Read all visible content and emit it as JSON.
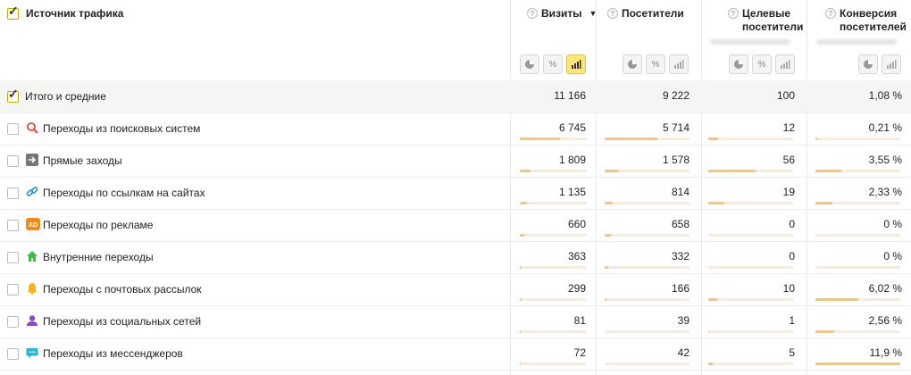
{
  "header": {
    "source_title": "Источник трафика",
    "columns": [
      {
        "id": "visits",
        "label": "Визиты",
        "sort": "▼"
      },
      {
        "id": "visitors",
        "label": "Посетители"
      },
      {
        "id": "target",
        "label": "Целевые посетители"
      },
      {
        "id": "conversion",
        "label": "Конверсия посетителей"
      }
    ]
  },
  "total": {
    "label": "Итого и средние",
    "visits": "11 166",
    "visitors": "9 222",
    "target": "100",
    "conversion": "1,08 %"
  },
  "rows": [
    {
      "label": "Переходы из поисковых систем",
      "icon": "search-icon",
      "visits": "6 745",
      "visitors": "5 714",
      "target": "12",
      "conversion": "0,21 %",
      "f": [
        0.6,
        0.62,
        0.12,
        0.02
      ]
    },
    {
      "label": "Прямые заходы",
      "icon": "arrow-right-icon",
      "visits": "1 809",
      "visitors": "1 578",
      "target": "56",
      "conversion": "3,55 %",
      "f": [
        0.16,
        0.17,
        0.56,
        0.3
      ]
    },
    {
      "label": "Переходы по ссылкам на сайтах",
      "icon": "link-icon",
      "visits": "1 135",
      "visitors": "814",
      "target": "19",
      "conversion": "2,33 %",
      "f": [
        0.1,
        0.09,
        0.19,
        0.2
      ]
    },
    {
      "label": "Переходы по рекламе",
      "icon": "ad-icon",
      "visits": "660",
      "visitors": "658",
      "target": "0",
      "conversion": "0 %",
      "f": [
        0.06,
        0.07,
        0,
        0
      ]
    },
    {
      "label": "Внутренние переходы",
      "icon": "home-icon",
      "visits": "363",
      "visitors": "332",
      "target": "0",
      "conversion": "0 %",
      "f": [
        0.03,
        0.04,
        0,
        0
      ]
    },
    {
      "label": "Переходы с почтовых рассылок",
      "icon": "bell-icon",
      "visits": "299",
      "visitors": "166",
      "target": "10",
      "conversion": "6,02 %",
      "f": [
        0.03,
        0.02,
        0.1,
        0.51
      ]
    },
    {
      "label": "Переходы из социальных сетей",
      "icon": "social-user-icon",
      "visits": "81",
      "visitors": "39",
      "target": "1",
      "conversion": "2,56 %",
      "f": [
        0.01,
        0.005,
        0.01,
        0.22
      ]
    },
    {
      "label": "Переходы из мессенджеров",
      "icon": "chat-icon",
      "visits": "72",
      "visitors": "42",
      "target": "5",
      "conversion": "11,9 %",
      "f": [
        0.01,
        0.005,
        0.05,
        1.0
      ]
    }
  ],
  "colors": {
    "bar": "#efc58e",
    "bar_track": "#f6ecdd",
    "active_toggle": "#ffe67a",
    "total_bg": "#f5f5f3"
  }
}
